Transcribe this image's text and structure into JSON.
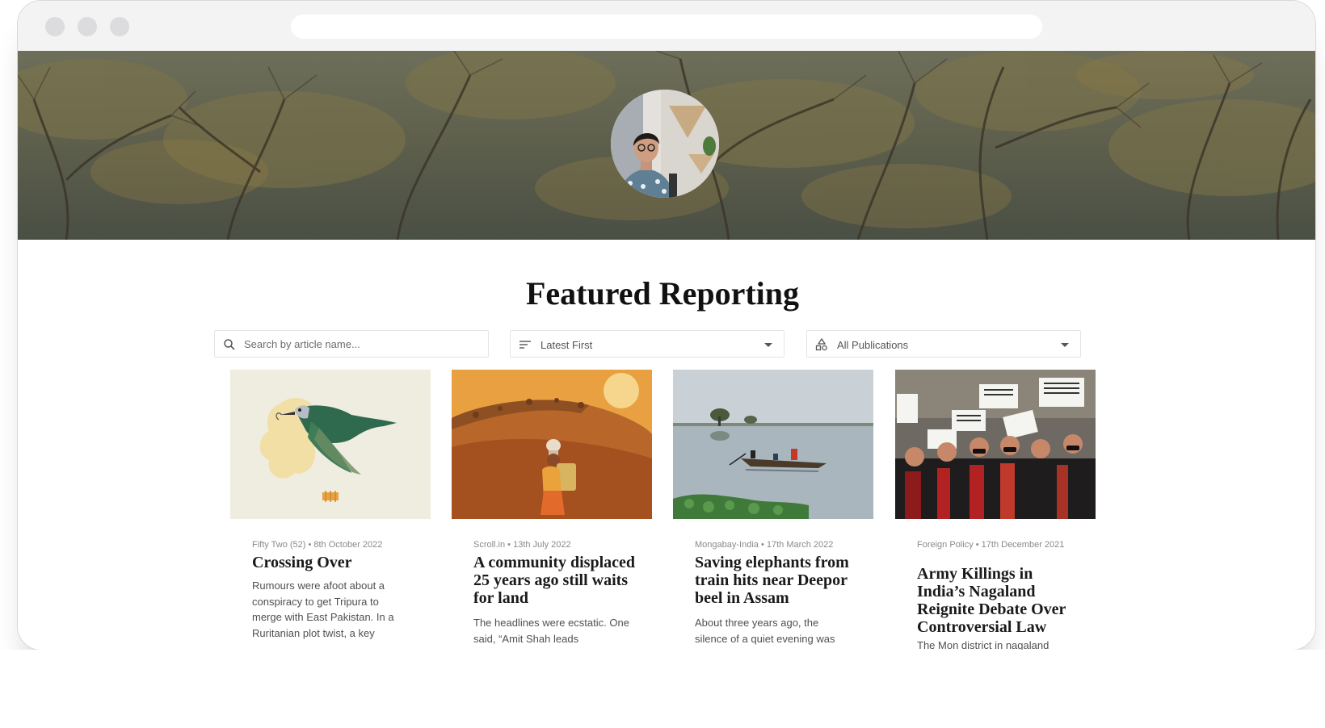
{
  "page": {
    "title": "Featured Reporting"
  },
  "profile": {
    "avatar_icon": "author-portrait"
  },
  "controls": {
    "search_placeholder": "Search by article name...",
    "search_icon": "search-icon",
    "sort_value": "Latest First",
    "sort_icon": "sort-lines-icon",
    "publication_value": "All Publications",
    "publication_icon": "shapes-icon"
  },
  "articles": [
    {
      "meta": "Fifty Two (52) • 8th October 2022",
      "headline": "Crossing Over",
      "excerpt": "Rumours were afoot about a conspiracy to get Tripura to merge with East Pakistan. In a Ruritanian plot twist, a key"
    },
    {
      "meta": "Scroll.in • 13th July 2022",
      "headline": "A community displaced 25 years ago still waits for land",
      "excerpt": "The headlines were ecstatic. One said, “Amit Shah leads"
    },
    {
      "meta": "Mongabay-India • 17th March 2022",
      "headline": "Saving elephants from train hits near Deepor beel in Assam",
      "excerpt": "About three years ago, the silence of a quiet evening was"
    },
    {
      "meta": "Foreign Policy • 17th December 2021",
      "headline": "Army Killings in India’s Nagaland Reignite Debate Over Controversial Law",
      "excerpt": "The Mon district in nagaland"
    }
  ],
  "colors": {
    "hero": "#5a614c",
    "text": "#111111",
    "meta": "#8a8a8a"
  }
}
